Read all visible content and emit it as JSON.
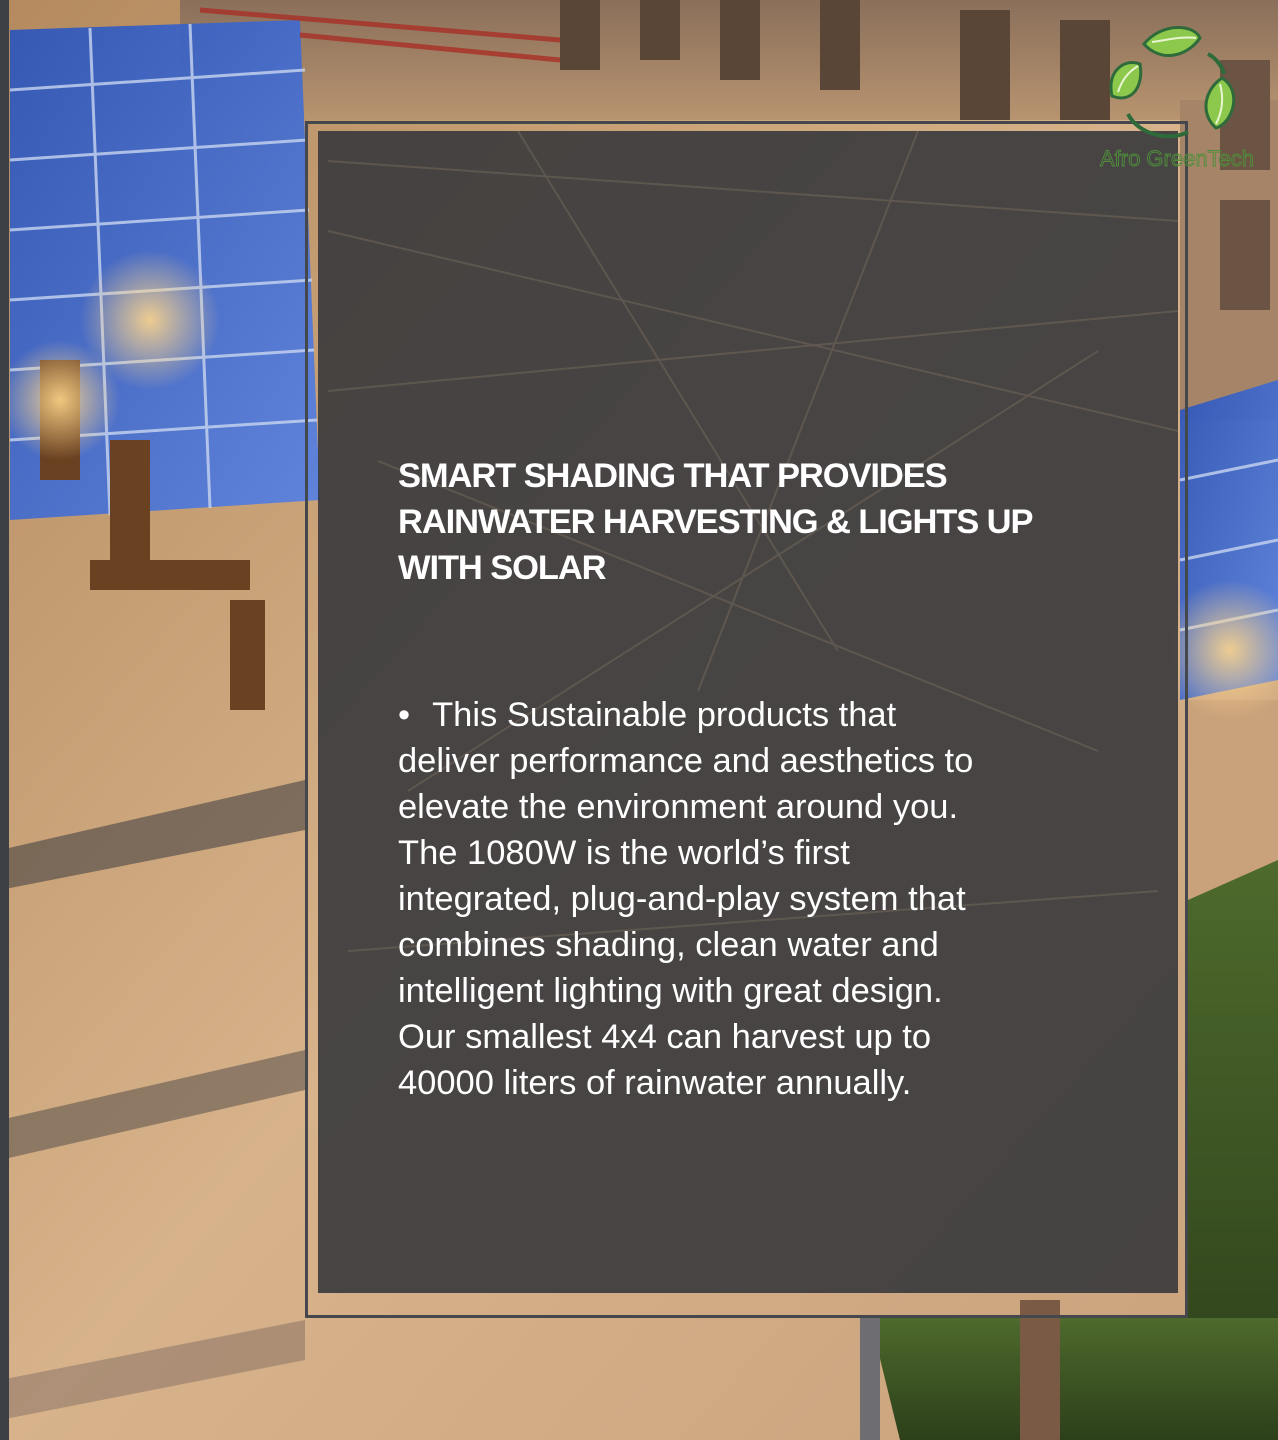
{
  "card": {
    "headline": "SMART SHADING THAT PROVIDES RAINWATER HARVESTING & LIGHTS UP WITH SOLAR",
    "bullet_symbol": "•",
    "body": "This Sustainable products that\ndeliver performance and aesthetics to\nelevate the environment around you.\nThe 1080W is the world’s first\nintegrated,  plug-and-play system that\ncombines  shading, clean water and\nintelligent  lighting with great design.\nOur smallest 4x4 can harvest up to\n40000 liters of rainwater annually."
  },
  "logo": {
    "text": "Afro GreenTech",
    "icon": "recycle-leaves-icon",
    "color": "#7bc043"
  },
  "background": {
    "description_icon": "solar-canopy-photo"
  },
  "colors": {
    "panel": "#37393c",
    "frame": "#44474b",
    "text": "#ffffff"
  }
}
